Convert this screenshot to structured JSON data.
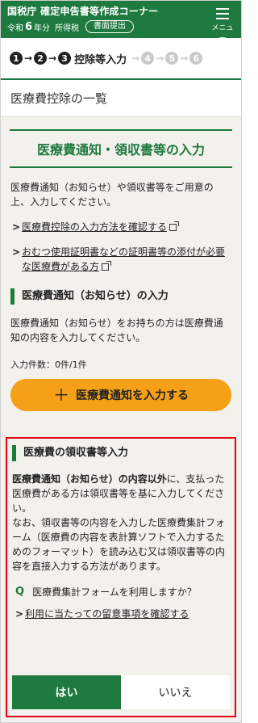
{
  "header": {
    "agency": "国税庁",
    "title": "確定申告書等作成コーナー",
    "era": "令和",
    "year": "6",
    "year_suffix": "年分",
    "tax_type": "所得税",
    "submit_label": "書面提出",
    "menu_label": "メニュー"
  },
  "steps": {
    "items": [
      "1",
      "2",
      "3",
      "4",
      "5",
      "6"
    ],
    "current_label": "控除等入力"
  },
  "page_title": "医療費控除の一覧",
  "main": {
    "section_title": "医療費通知・領収書等の入力",
    "intro": "医療費通知（お知らせ）や領収書等をご用意の上、入力してください。",
    "links": [
      "医療費控除の入力方法を確認する",
      "おむつ使用証明書などの証明書等の添付が必要な医療費がある方"
    ],
    "notice": {
      "heading": "医療費通知（お知らせ）の入力",
      "text": "医療費通知（お知らせ）をお持ちの方は医療費通知の内容を入力してください。",
      "count_label": "入力件数：0件/1件",
      "button_label": "医療費通知を入力する"
    },
    "receipt": {
      "heading": "医療費の領収書等入力",
      "text_bold": "医療費通知（お知らせ）の内容以外",
      "text_rest": "に、支払った医療費がある方は領収書等を基に入力してください。",
      "text2": "なお、領収書等の内容を入力した医療費集計フォーム（医療費の内容を表計算ソフトで入力するためのフォーマット）を読み込む又は領収書等の内容を直接入力する方法があります。",
      "question_mark": "Q",
      "question": "医療費集計フォームを利用しますか？",
      "link": "利用に当たっての留意事項を確認する",
      "yes_label": "はい",
      "no_label": "いいえ"
    }
  },
  "colors": {
    "brand_green": "#1f7a3f",
    "accent_orange": "#f5a017",
    "highlight_red": "#e60012",
    "main_bg": "#f3f1ec"
  }
}
